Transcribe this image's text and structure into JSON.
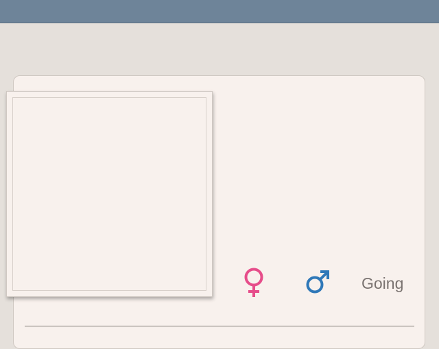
{
  "header": {
    "color": "#6e8499"
  },
  "card": {
    "background": "#f8f1ed",
    "photo": {
      "state": "empty"
    },
    "attendance": {
      "female_icon": "female-symbol-icon",
      "female_color": "#e64d8a",
      "male_icon": "male-symbol-icon",
      "male_color": "#2f78b8",
      "going_label": "Going"
    }
  }
}
